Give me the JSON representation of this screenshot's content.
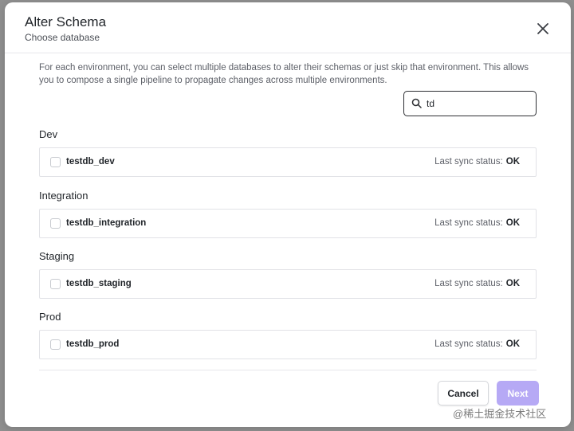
{
  "modal": {
    "title": "Alter Schema",
    "subtitle": "Choose database",
    "description": "For each environment, you can select multiple databases to alter their schemas or just skip that environment. This allows you to compose a single pipeline to propagate changes across multiple environments."
  },
  "search": {
    "value": "td",
    "icon": "search-icon"
  },
  "environments": [
    {
      "name": "Dev",
      "database": "testdb_dev",
      "sync_label": "Last sync status:",
      "sync_status": "OK"
    },
    {
      "name": "Integration",
      "database": "testdb_integration",
      "sync_label": "Last sync status:",
      "sync_status": "OK"
    },
    {
      "name": "Staging",
      "database": "testdb_staging",
      "sync_label": "Last sync status:",
      "sync_status": "OK"
    },
    {
      "name": "Prod",
      "database": "testdb_prod",
      "sync_label": "Last sync status:",
      "sync_status": "OK"
    }
  ],
  "footer": {
    "cancel_label": "Cancel",
    "next_label": "Next"
  },
  "watermark": "@稀土掘金技术社区",
  "colors": {
    "accent_disabled": "#b6a9f5",
    "border": "#e1e2e6",
    "search_border": "#2d2f33"
  }
}
